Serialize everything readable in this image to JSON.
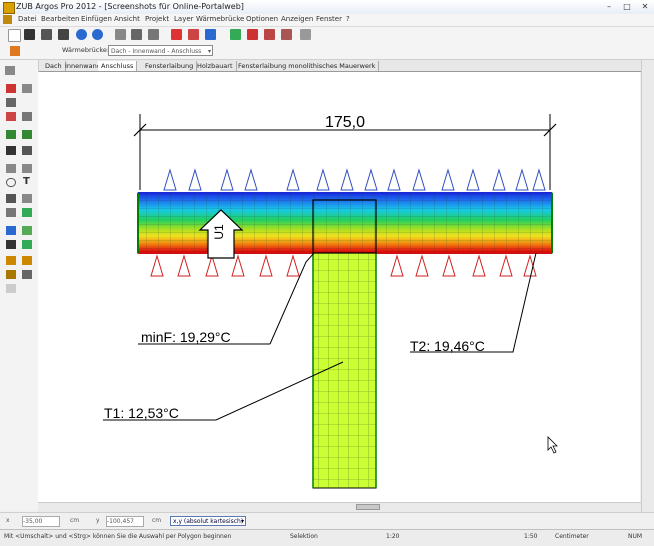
{
  "window": {
    "title": "ZUB Argos Pro 2012 - [Screenshots für Online-Portalweb]",
    "min": "–",
    "max": "□",
    "close": "✕"
  },
  "menu": [
    "Datei",
    "Bearbeiten",
    "Einfügen",
    "Ansicht",
    "Projekt",
    "Layer",
    "Wärmebrücke",
    "Optionen",
    "Anzeigen",
    "Fenster",
    "?"
  ],
  "toolbar2": {
    "label": "Wärmebrücke:",
    "combo_value": "Dach - Innenwand - Anschluss"
  },
  "tabs": [
    "Dach",
    "Innenwand",
    "Anschluss",
    "Fensterlaibung",
    "Holzbauart",
    "Fensterlaibung monolithisches Mauerwerk"
  ],
  "drawing": {
    "dimension": "175,0",
    "flux_label": "U1",
    "min_f": "minF: 19,29°C",
    "t2": "T2: 19,46°C",
    "t1": "T1: 12,53°C"
  },
  "coordbar": {
    "x_label": "x",
    "x_value": "-35,00",
    "unit1": "cm",
    "y_label": "y",
    "y_value": "-100,457",
    "unit2": "cm",
    "cs_value": "x,y (absolut kartesisch)"
  },
  "statusbar": {
    "hint": "Mit <Umschalt> und <Strg> können Sie die Auswahl per Polygon beginnen",
    "mode": "Selektion",
    "zoom": "1:20",
    "page": "1:50",
    "unit": "Centimeter",
    "num": "NUM"
  },
  "colors": {
    "accent": "#3264b4",
    "warm_region": "#ccff33",
    "cold_edge": "#1a2bd6"
  }
}
